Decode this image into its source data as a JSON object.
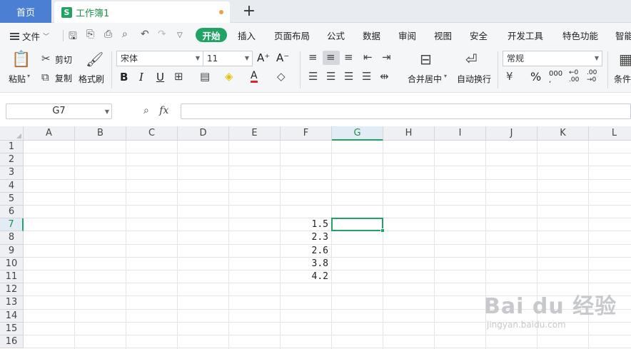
{
  "tabs": {
    "home": "首页",
    "doc": "工作簿1",
    "doc_icon": "S",
    "add": "+"
  },
  "menu": {
    "file": "文件",
    "active": "开始",
    "items": [
      "插入",
      "页面布局",
      "公式",
      "数据",
      "审阅",
      "视图",
      "安全",
      "开发工具",
      "特色功能",
      "智能"
    ]
  },
  "ribbon": {
    "paste": "粘贴",
    "cut": "剪切",
    "copy": "复制",
    "format_painter": "格式刷",
    "font_name": "宋体",
    "font_size": "11",
    "grow": "A⁺",
    "shrink": "A⁻",
    "merge": "合并居中",
    "wrap": "自动换行",
    "number_format": "常规",
    "percent": "%",
    "conditional": "条件"
  },
  "formula_bar": {
    "name_box": "G7",
    "fx": "fx",
    "formula": ""
  },
  "columns": [
    "A",
    "B",
    "C",
    "D",
    "E",
    "F",
    "G",
    "H",
    "I",
    "J",
    "K",
    "L"
  ],
  "rows": [
    "1",
    "2",
    "3",
    "4",
    "5",
    "6",
    "7",
    "8",
    "9",
    "10",
    "11",
    "12",
    "13",
    "14",
    "15",
    "16"
  ],
  "selected": {
    "column": "G",
    "row": "7"
  },
  "cells": {
    "F7": "1.5",
    "F8": "2.3",
    "F9": "2.6",
    "F10": "3.8",
    "F11": "4.2"
  },
  "watermark": {
    "brand": "Bai du 经验",
    "url": "jingyan.baidu.com"
  },
  "colors": {
    "accent": "#21a366",
    "home_tab": "#4a7fd4"
  }
}
